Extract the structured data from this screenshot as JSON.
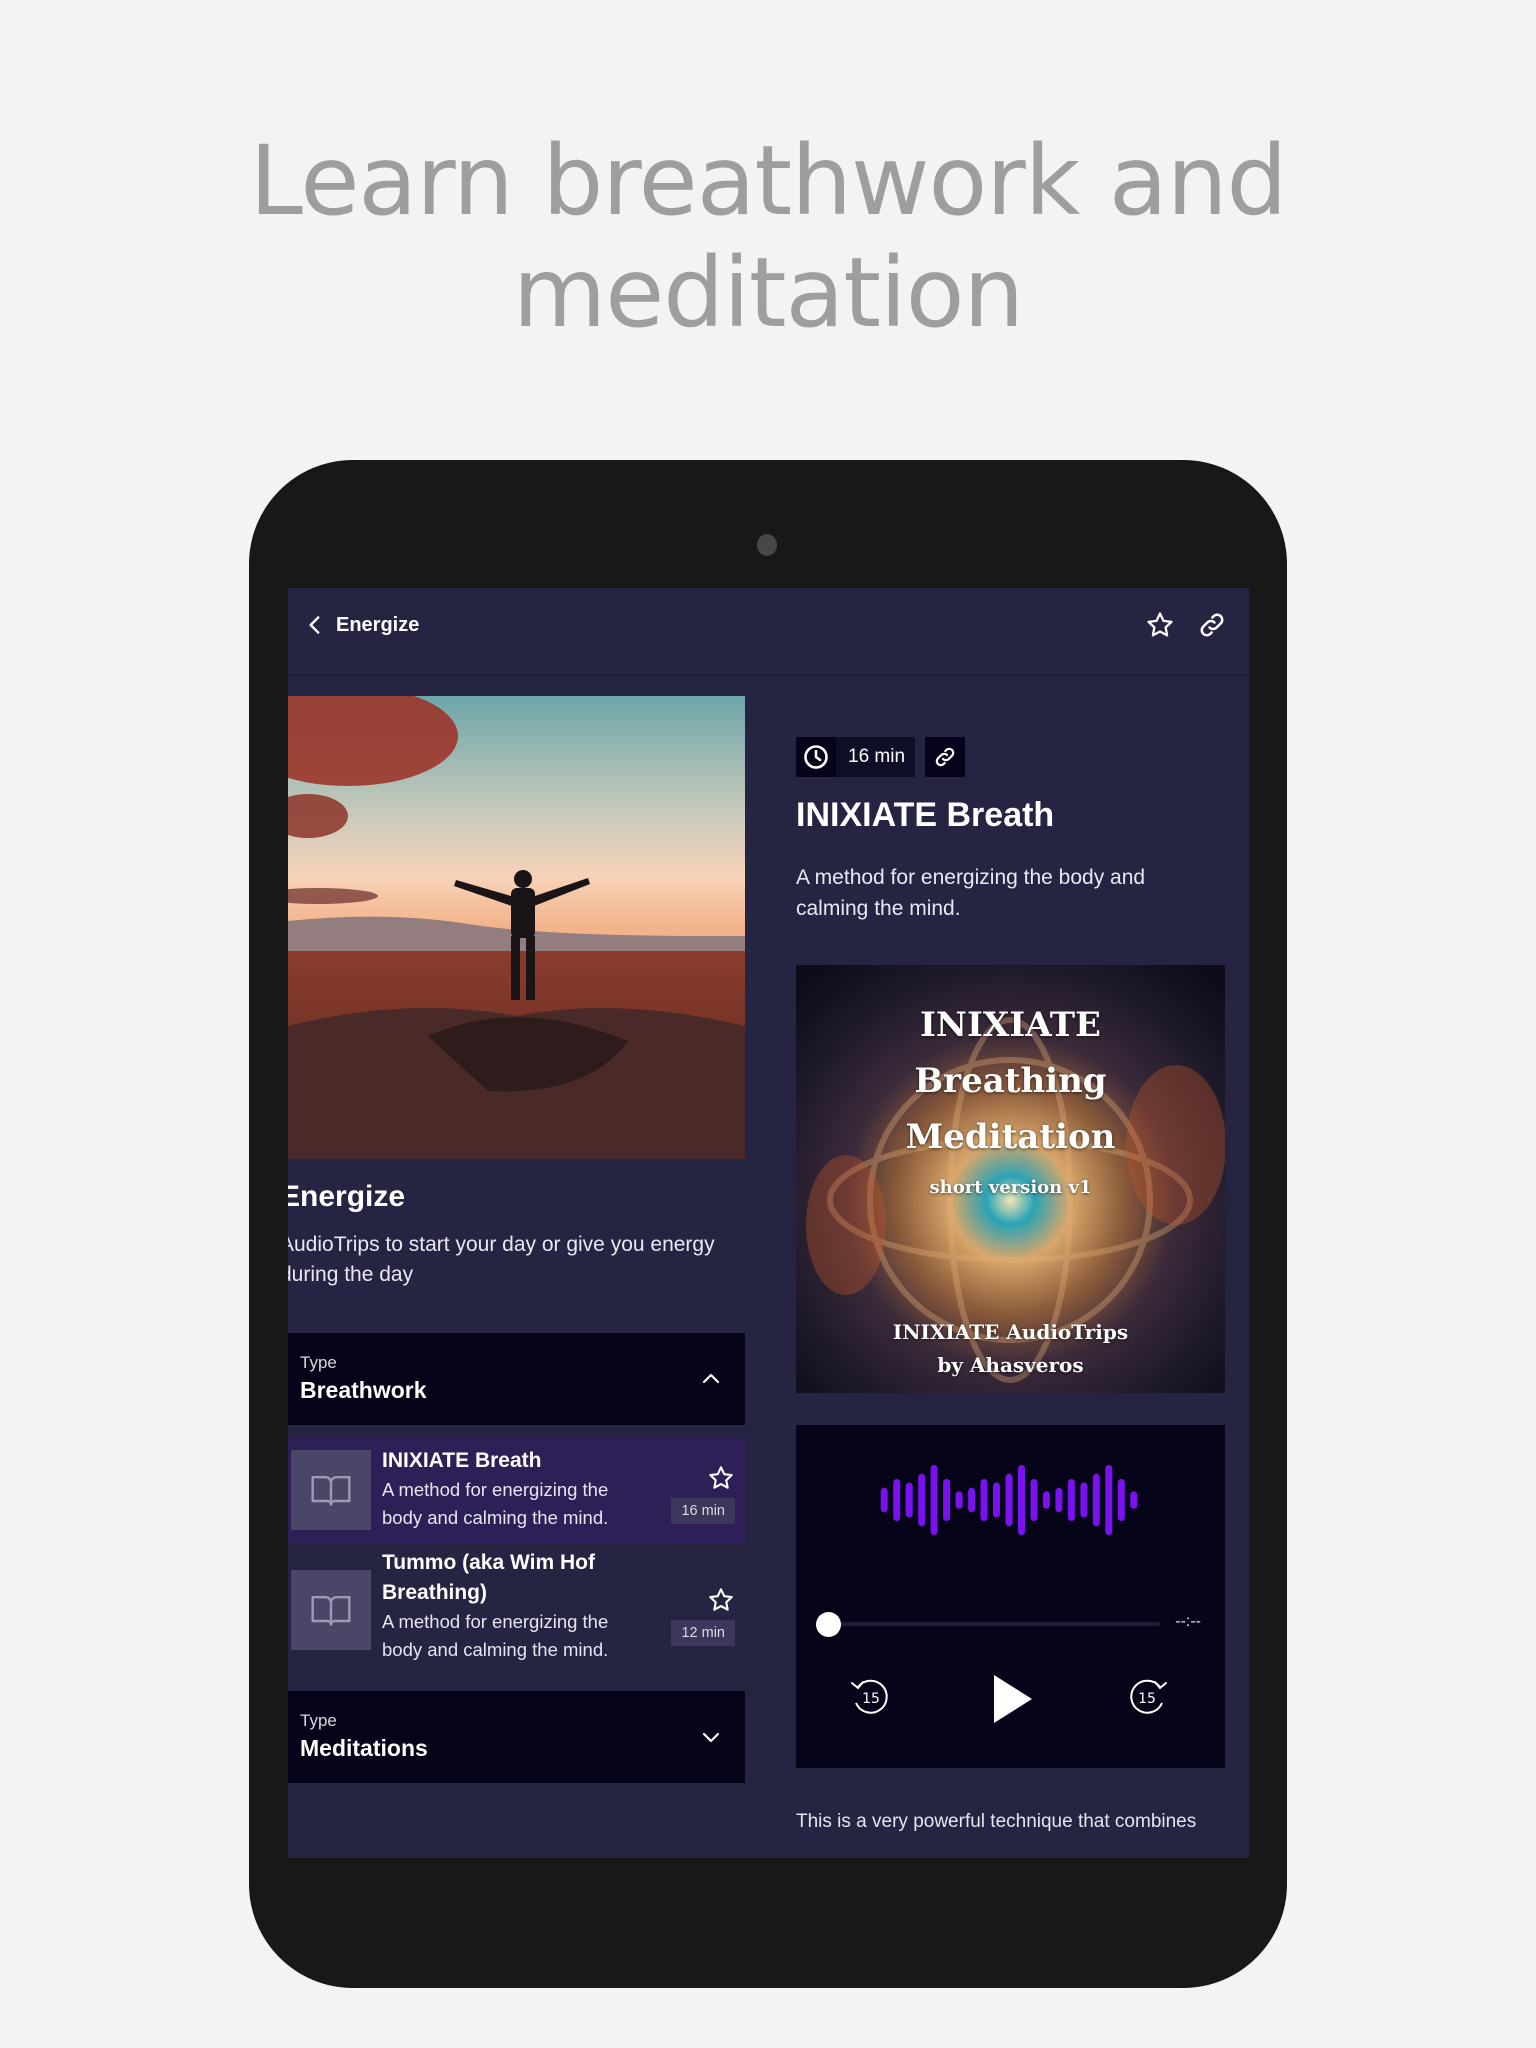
{
  "promo": {
    "headline_line1": "Learn breathwork and",
    "headline_line2": "meditation"
  },
  "appbar": {
    "back_label": "Energize",
    "icons": [
      "chevron-left-icon",
      "star-outline-icon",
      "link-icon"
    ]
  },
  "category": {
    "title": "Energize",
    "description": "AudioTrips to start your day or give you energy during the day",
    "hero_image": "person-arms-raised-sunset-rocks"
  },
  "groups": [
    {
      "type_label": "Type",
      "type_value": "Breathwork",
      "expanded": true,
      "tracks": [
        {
          "title": "INIXIATE Breath",
          "description": "A method for energizing the body and calming the mind.",
          "duration": "16 min",
          "active": true,
          "favorite": false
        },
        {
          "title": "Tummo (aka Wim Hof Breathing)",
          "description": "A method for energizing the body and calming the mind.",
          "duration": "12 min",
          "active": false,
          "favorite": false
        }
      ]
    },
    {
      "type_label": "Type",
      "type_value": "Meditations",
      "expanded": false,
      "tracks": []
    }
  ],
  "trip": {
    "duration": "16 min",
    "title": "INIXIATE Breath",
    "description": "A method for energizing the body and calming the mind.",
    "cover": {
      "line1": "INIXIATE",
      "line2": "Breathing",
      "line3": "Meditation",
      "line4": "short version v1",
      "line5": "INIXIATE AudioTrips",
      "line6": "by Ahasveros"
    },
    "long_description": "This is a very powerful technique that combines"
  },
  "player": {
    "progress": 0,
    "time_remaining": "--:--",
    "rewind_seconds": "15",
    "forward_seconds": "15",
    "wave_color": "#7a12f0",
    "wave_levels": [
      0.35,
      0.6,
      0.5,
      0.75,
      1.0,
      0.6,
      0.25,
      0.35,
      0.6,
      0.5,
      0.75,
      1.0,
      0.6,
      0.25,
      0.35,
      0.6,
      0.5,
      0.75,
      1.0,
      0.6,
      0.25
    ]
  },
  "colors": {
    "screen_bg": "#262443",
    "panel_bg": "#050418",
    "active_row": "#2e2057",
    "accent": "#7a12f0"
  }
}
